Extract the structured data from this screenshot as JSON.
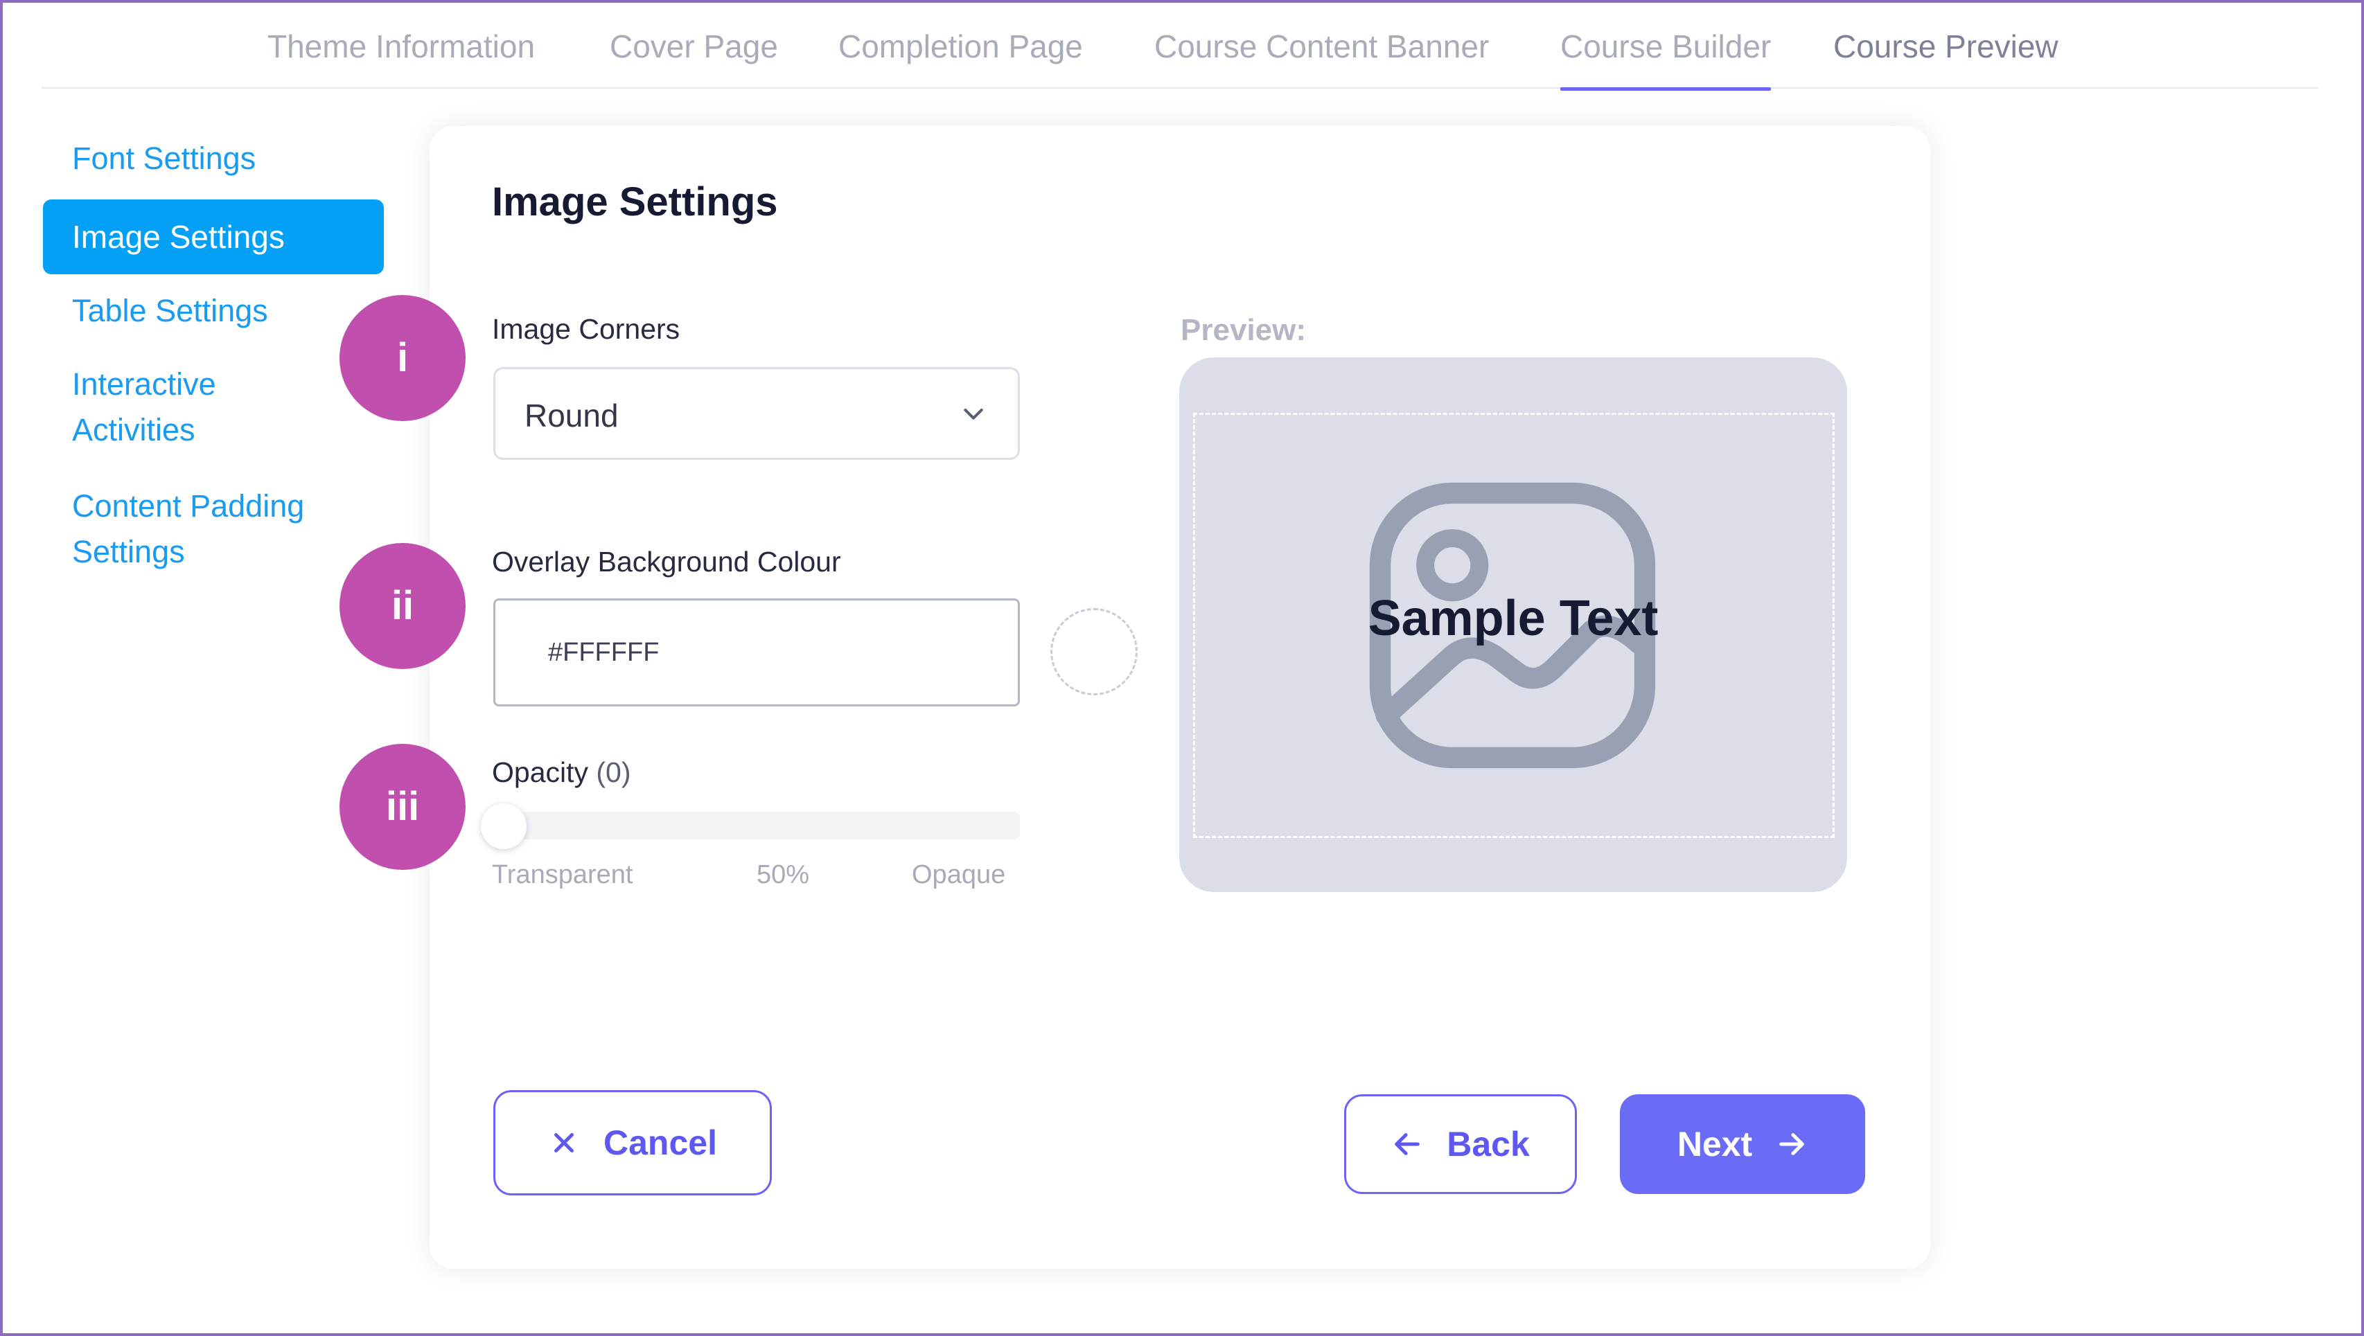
{
  "tabs": [
    {
      "label": "Theme Information"
    },
    {
      "label": "Cover Page"
    },
    {
      "label": "Completion Page"
    },
    {
      "label": "Course Content Banner"
    },
    {
      "label": "Course Builder"
    },
    {
      "label": "Course Preview"
    }
  ],
  "active_tab": "Course Builder",
  "sidebar": {
    "items": [
      {
        "label": "Font Settings"
      },
      {
        "label": "Image Settings"
      },
      {
        "label": "Table Settings"
      },
      {
        "label_line1": "Interactive",
        "label_line2": "Activities"
      },
      {
        "label_line1": "Content Padding",
        "label_line2": "Settings"
      }
    ],
    "active": "Image Settings"
  },
  "card": {
    "title": "Image Settings",
    "image_corners": {
      "label": "Image Corners",
      "value": "Round"
    },
    "overlay_colour": {
      "label": "Overlay Background Colour",
      "value": "#FFFFFF"
    },
    "opacity": {
      "label": "Opacity",
      "value_text": "(0)",
      "value": 0,
      "min_label": "Transparent",
      "mid_label": "50%",
      "max_label": "Opaque"
    },
    "preview": {
      "label": "Preview:",
      "sample_text": "Sample Text"
    }
  },
  "badges": [
    "i",
    "ii",
    "iii"
  ],
  "buttons": {
    "cancel": "Cancel",
    "back": "Back",
    "next": "Next"
  },
  "colors": {
    "accent": "#6a63f6",
    "sidebar_active": "#03a0f6",
    "badge": "#c14fae",
    "link": "#1a9bef"
  },
  "icons": [
    "chevron-down-icon",
    "image-placeholder-icon",
    "close-icon",
    "arrow-left-icon",
    "arrow-right-icon"
  ]
}
